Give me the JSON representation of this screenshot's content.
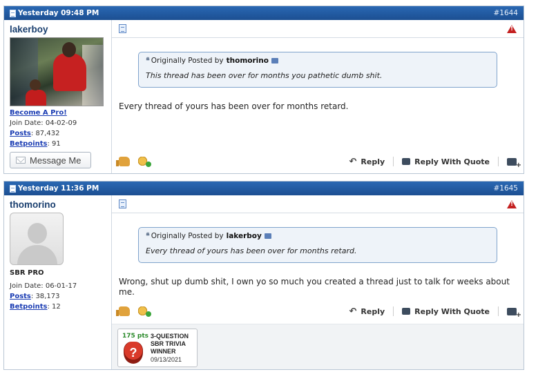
{
  "posts": [
    {
      "date": "Yesterday 09:48 PM",
      "number": "#1644",
      "user": {
        "name": "lakerboy",
        "rank": "Become A Pro!",
        "join_label": "Join Date:",
        "join_date": "04-02-09",
        "posts_label": "Posts",
        "posts": ": 87,432",
        "betpoints_label": "Betpoints",
        "betpoints": ": 91",
        "message_button": "Message Me"
      },
      "quote": {
        "prefix": "Originally Posted by",
        "author": "thomorino",
        "text": "This thread has been over for months you pathetic dumb shit."
      },
      "message": "Every thread of yours has been over for months retard.",
      "actions": {
        "reply": "Reply",
        "reply_with_quote": "Reply With Quote"
      }
    },
    {
      "date": "Yesterday 11:36 PM",
      "number": "#1645",
      "user": {
        "name": "thomorino",
        "rank": "SBR PRO",
        "join_label": "Join Date:",
        "join_date": "06-01-17",
        "posts_label": "Posts",
        "posts": ": 38,173",
        "betpoints_label": "Betpoints",
        "betpoints": ": 12"
      },
      "quote": {
        "prefix": "Originally Posted by",
        "author": "lakerboy",
        "text": "Every thread of yours has been over for months retard."
      },
      "message": "Wrong, shut up dumb shit, I own yo so much you created a thread just to talk for weeks about me.",
      "actions": {
        "reply": "Reply",
        "reply_with_quote": "Reply With Quote"
      },
      "award": {
        "points": "175 pts",
        "badge_symbol": "?",
        "title": "3-QUESTION SBR TRIVIA WINNER",
        "date": "09/13/2021"
      }
    }
  ],
  "icons": {
    "doc": "document-icon",
    "warn": "report-post-icon",
    "like": "thumbs-up-icon",
    "reward": "reward-icon",
    "reply": "reply-icon",
    "reply_with_quote": "quote-icon",
    "multi_quote": "multi-quote-icon"
  },
  "colors": {
    "header_blue": "#1c4f92",
    "link_blue": "#1b3db3",
    "quote_bg": "#eef3f9",
    "quote_border": "#7fa3cc",
    "warn_red": "#c42020"
  }
}
